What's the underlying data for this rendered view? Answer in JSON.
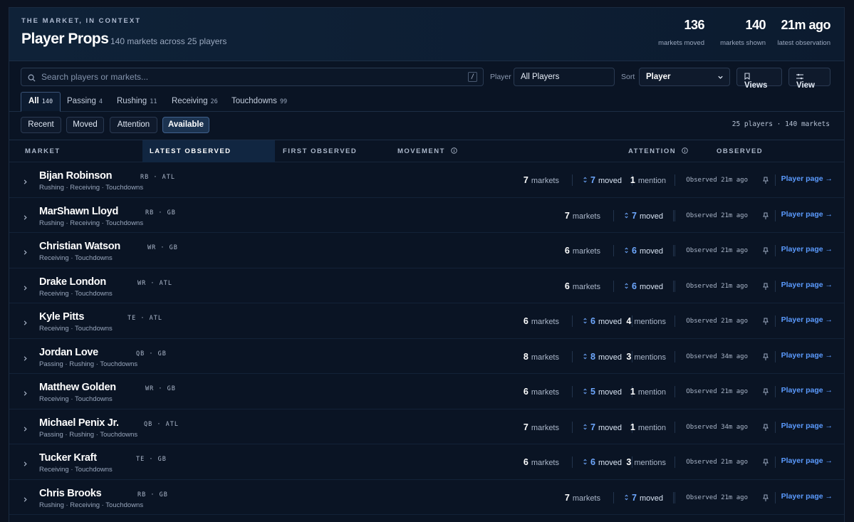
{
  "header": {
    "eyebrow": "THE MARKET, IN CONTEXT",
    "title": "Player Props",
    "subtitle": "140 markets across 25 players",
    "stats": [
      {
        "value": "136",
        "label": "markets moved"
      },
      {
        "value": "140",
        "label": "markets shown"
      },
      {
        "value": "21m ago",
        "label": "latest observation"
      }
    ]
  },
  "toolbar": {
    "search_placeholder": "Search players or markets...",
    "search_shortcut": "/",
    "player_label": "Player",
    "player_value": "All Players",
    "sort_label": "Sort",
    "sort_value": "Player",
    "views_button": "Views",
    "view_button": "View"
  },
  "tabs": [
    {
      "label": "All",
      "count": "140"
    },
    {
      "label": "Passing",
      "count": "4"
    },
    {
      "label": "Rushing",
      "count": "11"
    },
    {
      "label": "Receiving",
      "count": "26"
    },
    {
      "label": "Touchdowns",
      "count": "99"
    }
  ],
  "filters": {
    "chips": [
      "Recent",
      "Moved",
      "Attention",
      "Available"
    ],
    "active": "Available",
    "summary": "25 players · 140 markets"
  },
  "columns": {
    "market": "MARKET",
    "latest_observed": "LATEST OBSERVED",
    "first_observed": "FIRST OBSERVED",
    "movement": "MOVEMENT",
    "attention": "ATTENTION",
    "observed": "OBSERVED"
  },
  "row_text": {
    "markets_label": "markets",
    "moved_label": "moved",
    "player_page": "Player page →"
  },
  "players": [
    {
      "name": "Bijan Robinson",
      "pos": "RB · ATL",
      "tags": "Rushing · Receiving · Touchdowns",
      "markets": "7",
      "moved": "7",
      "mentions": "1",
      "mentions_label": "mention",
      "observed": "Observed 21m ago"
    },
    {
      "name": "MarShawn Lloyd",
      "pos": "RB · GB",
      "tags": "Rushing · Receiving · Touchdowns",
      "markets": "7",
      "moved": "7",
      "mentions": "",
      "mentions_label": "",
      "observed": "Observed 21m ago"
    },
    {
      "name": "Christian Watson",
      "pos": "WR · GB",
      "tags": "Receiving · Touchdowns",
      "markets": "6",
      "moved": "6",
      "mentions": "",
      "mentions_label": "",
      "observed": "Observed 21m ago"
    },
    {
      "name": "Drake London",
      "pos": "WR · ATL",
      "tags": "Receiving · Touchdowns",
      "markets": "6",
      "moved": "6",
      "mentions": "",
      "mentions_label": "",
      "observed": "Observed 21m ago"
    },
    {
      "name": "Kyle Pitts",
      "pos": "TE · ATL",
      "tags": "Receiving · Touchdowns",
      "markets": "6",
      "moved": "6",
      "mentions": "4",
      "mentions_label": "mentions",
      "observed": "Observed 21m ago"
    },
    {
      "name": "Jordan Love",
      "pos": "QB · GB",
      "tags": "Passing · Rushing · Touchdowns",
      "markets": "8",
      "moved": "8",
      "mentions": "3",
      "mentions_label": "mentions",
      "observed": "Observed 34m ago"
    },
    {
      "name": "Matthew Golden",
      "pos": "WR · GB",
      "tags": "Receiving · Touchdowns",
      "markets": "6",
      "moved": "5",
      "mentions": "1",
      "mentions_label": "mention",
      "observed": "Observed 21m ago"
    },
    {
      "name": "Michael Penix Jr.",
      "pos": "QB · ATL",
      "tags": "Passing · Rushing · Touchdowns",
      "markets": "7",
      "moved": "7",
      "mentions": "1",
      "mentions_label": "mention",
      "observed": "Observed 34m ago"
    },
    {
      "name": "Tucker Kraft",
      "pos": "TE · GB",
      "tags": "Receiving · Touchdowns",
      "markets": "6",
      "moved": "6",
      "mentions": "3",
      "mentions_label": "mentions",
      "observed": "Observed 21m ago"
    },
    {
      "name": "Chris Brooks",
      "pos": "RB · GB",
      "tags": "Rushing · Receiving · Touchdowns",
      "markets": "7",
      "moved": "7",
      "mentions": "",
      "mentions_label": "",
      "observed": "Observed 21m ago"
    }
  ],
  "colors": {
    "accent": "#5b9bff",
    "moved": "#6ea8ff",
    "background": "#0a1424"
  },
  "icons": [
    "search-icon",
    "chevron-down-icon",
    "bookmark-icon",
    "sliders-icon",
    "info-icon",
    "chevron-right-icon",
    "updown-arrow-icon",
    "pin-icon"
  ]
}
